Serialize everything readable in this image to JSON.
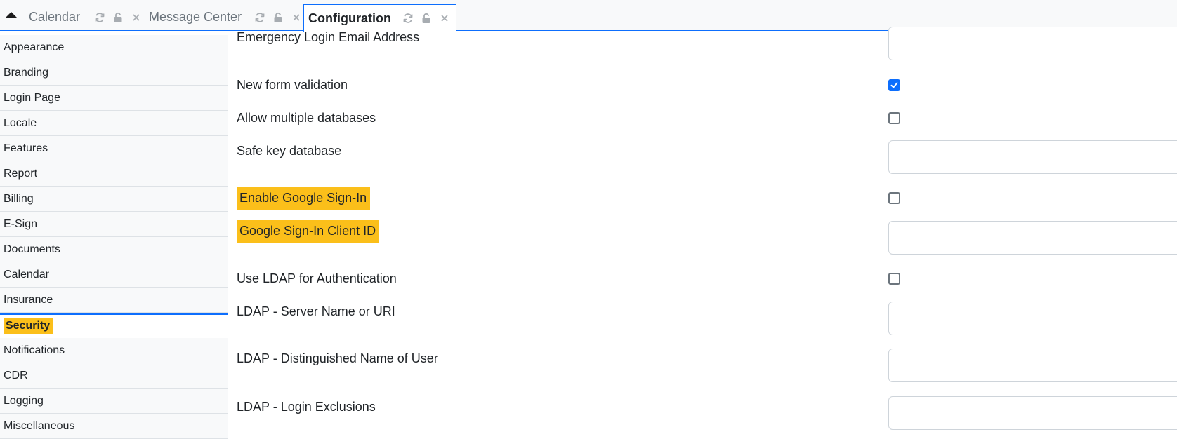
{
  "tabs": [
    {
      "label": "Calendar"
    },
    {
      "label": "Message Center"
    },
    {
      "label": "Configuration"
    }
  ],
  "sidebar": {
    "items": [
      {
        "label": "Appearance"
      },
      {
        "label": "Branding"
      },
      {
        "label": "Login Page"
      },
      {
        "label": "Locale"
      },
      {
        "label": "Features"
      },
      {
        "label": "Report"
      },
      {
        "label": "Billing"
      },
      {
        "label": "E-Sign"
      },
      {
        "label": "Documents"
      },
      {
        "label": "Calendar"
      },
      {
        "label": "Insurance"
      },
      {
        "label": "Security"
      },
      {
        "label": "Notifications"
      },
      {
        "label": "CDR"
      },
      {
        "label": "Logging"
      },
      {
        "label": "Miscellaneous"
      }
    ],
    "active": "Security"
  },
  "form": {
    "fields": [
      {
        "label": "Emergency Login Email Address",
        "type": "text",
        "value": ""
      },
      {
        "label": "New form validation",
        "type": "checkbox",
        "checked": true
      },
      {
        "label": "Allow multiple databases",
        "type": "checkbox",
        "checked": false
      },
      {
        "label": "Safe key database",
        "type": "text",
        "value": ""
      },
      {
        "label": "Enable Google Sign-In",
        "type": "checkbox",
        "checked": false,
        "highlighted": true
      },
      {
        "label": "Google Sign-In Client ID",
        "type": "text",
        "value": "",
        "highlighted": true
      },
      {
        "label": "Use LDAP for Authentication",
        "type": "checkbox",
        "checked": false
      },
      {
        "label": "LDAP - Server Name or URI",
        "type": "text",
        "value": ""
      },
      {
        "label": "LDAP - Distinguished Name of User",
        "type": "text",
        "value": ""
      },
      {
        "label": "LDAP - Login Exclusions",
        "type": "text",
        "value": ""
      }
    ]
  },
  "colors": {
    "accent": "#0d6efd",
    "highlight": "#fbbf1a"
  },
  "icons": [
    "collapse-up-icon",
    "refresh-icon",
    "unlock-icon",
    "close-icon",
    "check-icon"
  ]
}
